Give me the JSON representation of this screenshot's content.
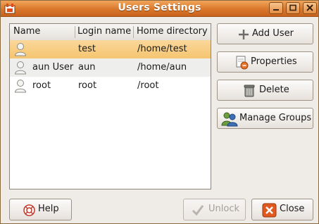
{
  "window": {
    "title": "Users Settings"
  },
  "table": {
    "headers": [
      "Name",
      "Login name",
      "Home directory"
    ],
    "rows": [
      {
        "name": "",
        "login": "test",
        "home": "/home/test",
        "selected": true
      },
      {
        "name": "aun User",
        "login": "aun",
        "home": "/home/aun",
        "selected": false
      },
      {
        "name": "root",
        "login": "root",
        "home": "/root",
        "selected": false
      }
    ]
  },
  "buttons": {
    "add_user": "Add User",
    "properties": "Properties",
    "delete": "Delete",
    "manage_groups": "Manage Groups",
    "help": "Help",
    "unlock": "Unlock",
    "close": "Close"
  },
  "colors": {
    "titlebar": "#d9772b",
    "selection": "#f5c570",
    "close_accent": "#e05a1f"
  }
}
